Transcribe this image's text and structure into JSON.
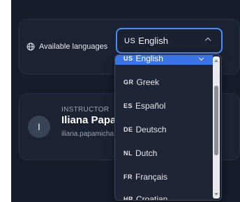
{
  "language_setting": {
    "label": "Available languages",
    "icon": "globe-icon",
    "selected": {
      "code": "US",
      "name": "English"
    },
    "accent_color": "#4c8ef5"
  },
  "dropdown": {
    "options": [
      {
        "code": "US",
        "name": "English",
        "selected": true
      },
      {
        "code": "GR",
        "name": "Greek"
      },
      {
        "code": "ES",
        "name": "Español"
      },
      {
        "code": "DE",
        "name": "Deutsch"
      },
      {
        "code": "NL",
        "name": "Dutch"
      },
      {
        "code": "FR",
        "name": "Français"
      },
      {
        "code": "HR",
        "name": "Croatian"
      }
    ],
    "highlight_color": "#3b74e6"
  },
  "instructor": {
    "role": "INSTRUCTOR",
    "avatar_initial": "I",
    "name": "Iliana Papam",
    "email": "iliana.papamicha"
  }
}
